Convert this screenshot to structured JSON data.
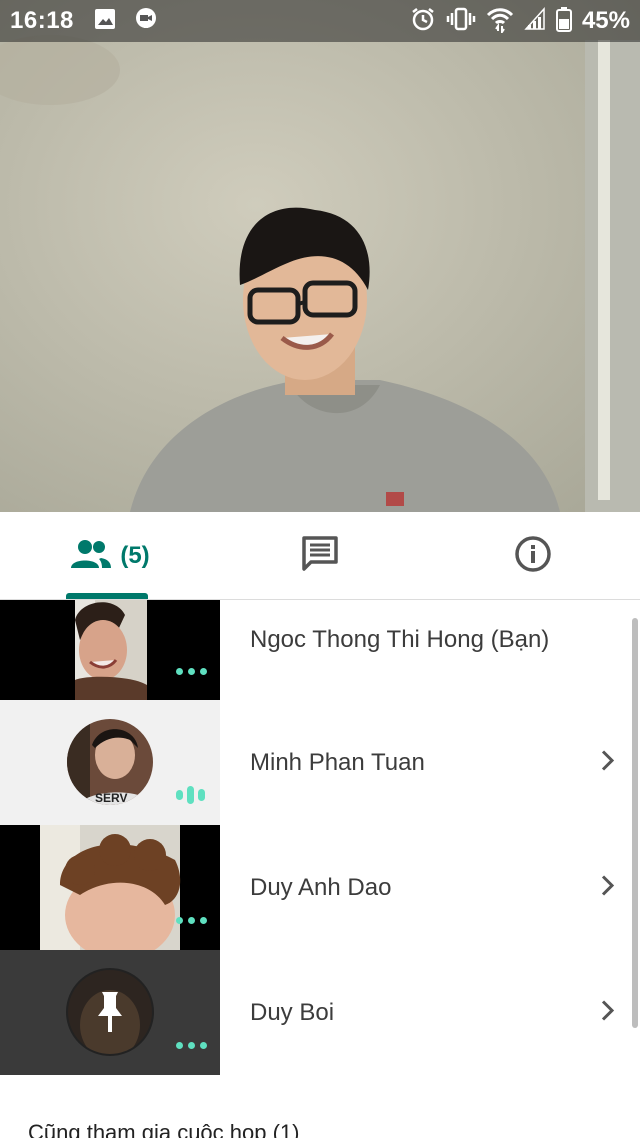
{
  "status_bar": {
    "time": "16:18",
    "battery": "45%",
    "icons": [
      "image-icon",
      "hangouts-meet-icon",
      "alarm-icon",
      "vibrate-icon",
      "wifi-icon",
      "signal-icon",
      "battery-icon"
    ]
  },
  "tabs": {
    "people_count": "(5)",
    "icons": [
      "people-icon",
      "chat-icon",
      "info-icon"
    ],
    "accent_color": "#00796b"
  },
  "participants": [
    {
      "name": "Ngoc Thong Thi Hong (Bạn)",
      "status": "dots"
    },
    {
      "name": "Minh Phan Tuan",
      "status": "speaking"
    },
    {
      "name": "Duy Anh Dao",
      "status": "dots"
    },
    {
      "name": "Duy Boi",
      "status": "dots"
    }
  ],
  "section": {
    "also_in_meeting": "Cũng tham gia cuộc họp (1)"
  }
}
